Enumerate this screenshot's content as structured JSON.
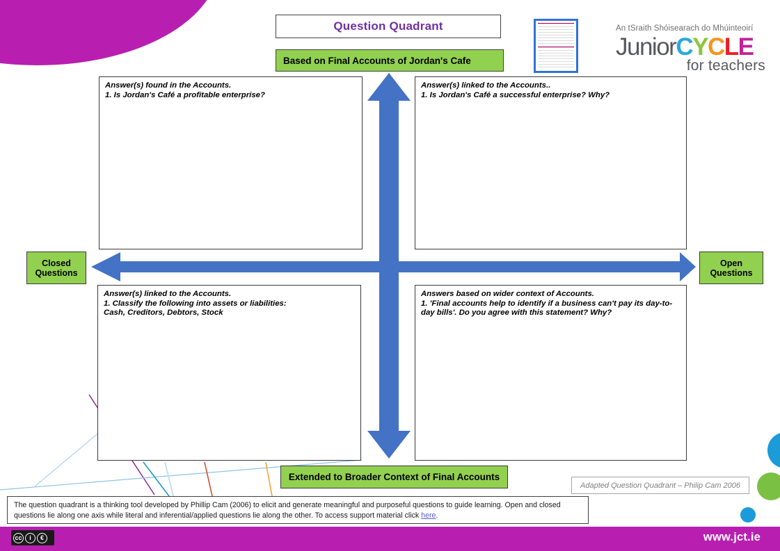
{
  "header": {
    "title": "Question Quadrant",
    "subtitle": "Based on Final Accounts of Jordan's Cafe"
  },
  "logo": {
    "tagline": "An tSraith Shóisearach do Mhúinteoirí",
    "word_junior": "Junior",
    "word_c": "C",
    "word_y": "Y",
    "word_c2": "C",
    "word_l": "L",
    "word_e": "E",
    "word_for_teachers": "for teachers"
  },
  "quadrants": {
    "top_left": {
      "heading": "Answer(s) found in the Accounts.",
      "body": "1. Is Jordan's Café a profitable enterprise?"
    },
    "top_right": {
      "heading": "Answer(s) linked to the Accounts..",
      "body": "1. Is Jordan's Café a successful enterprise? Why?"
    },
    "bottom_left": {
      "heading": "Answer(s) linked to the Accounts.",
      "body": "1. Classify the following into assets or liabilities:\nCash, Creditors, Debtors, Stock"
    },
    "bottom_right": {
      "heading": "Answers based on wider context of Accounts.",
      "body": "1. 'Final accounts help to identify if a business can't pay its day-to-day bills'.  Do you agree with this statement? Why?"
    }
  },
  "axes": {
    "left_label": "Closed\nQuestions",
    "right_label": "Open\nQuestions",
    "bottom_label": "Extended to Broader Context of Final Accounts"
  },
  "attribution": "Adapted Question Quadrant – Philip Cam 2006",
  "footnote": {
    "part1": "The question quadrant is a thinking tool developed by Phillip Cam (2006) to elicit and generate meaningful and purposeful questions to guide learning. Open and closed questions lie along one axis while literal and inferential/applied questions lie along the other.   To access support material click ",
    "link": "here",
    "part2": "."
  },
  "footer": {
    "url": "www.jct.ie",
    "cc_mark": "cc",
    "cc_by": "BY",
    "cc_nc": "NC"
  },
  "colors": {
    "brand_magenta": "#b81fb0",
    "green_accent": "#92d050",
    "arrow_blue": "#4472c4",
    "title_purple": "#7030a0"
  }
}
